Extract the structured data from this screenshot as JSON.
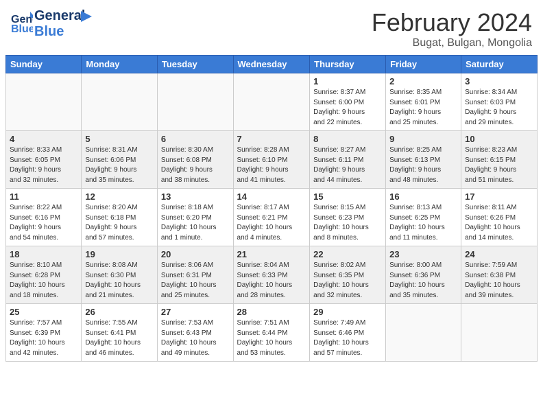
{
  "header": {
    "logo_line1": "General",
    "logo_line2": "Blue",
    "main_title": "February 2024",
    "subtitle": "Bugat, Bulgan, Mongolia"
  },
  "days_of_week": [
    "Sunday",
    "Monday",
    "Tuesday",
    "Wednesday",
    "Thursday",
    "Friday",
    "Saturday"
  ],
  "weeks": [
    [
      {
        "day": "",
        "info": "",
        "empty": true
      },
      {
        "day": "",
        "info": "",
        "empty": true
      },
      {
        "day": "",
        "info": "",
        "empty": true
      },
      {
        "day": "",
        "info": "",
        "empty": true
      },
      {
        "day": "1",
        "info": "Sunrise: 8:37 AM\nSunset: 6:00 PM\nDaylight: 9 hours\nand 22 minutes."
      },
      {
        "day": "2",
        "info": "Sunrise: 8:35 AM\nSunset: 6:01 PM\nDaylight: 9 hours\nand 25 minutes."
      },
      {
        "day": "3",
        "info": "Sunrise: 8:34 AM\nSunset: 6:03 PM\nDaylight: 9 hours\nand 29 minutes."
      }
    ],
    [
      {
        "day": "4",
        "info": "Sunrise: 8:33 AM\nSunset: 6:05 PM\nDaylight: 9 hours\nand 32 minutes."
      },
      {
        "day": "5",
        "info": "Sunrise: 8:31 AM\nSunset: 6:06 PM\nDaylight: 9 hours\nand 35 minutes."
      },
      {
        "day": "6",
        "info": "Sunrise: 8:30 AM\nSunset: 6:08 PM\nDaylight: 9 hours\nand 38 minutes."
      },
      {
        "day": "7",
        "info": "Sunrise: 8:28 AM\nSunset: 6:10 PM\nDaylight: 9 hours\nand 41 minutes."
      },
      {
        "day": "8",
        "info": "Sunrise: 8:27 AM\nSunset: 6:11 PM\nDaylight: 9 hours\nand 44 minutes."
      },
      {
        "day": "9",
        "info": "Sunrise: 8:25 AM\nSunset: 6:13 PM\nDaylight: 9 hours\nand 48 minutes."
      },
      {
        "day": "10",
        "info": "Sunrise: 8:23 AM\nSunset: 6:15 PM\nDaylight: 9 hours\nand 51 minutes."
      }
    ],
    [
      {
        "day": "11",
        "info": "Sunrise: 8:22 AM\nSunset: 6:16 PM\nDaylight: 9 hours\nand 54 minutes."
      },
      {
        "day": "12",
        "info": "Sunrise: 8:20 AM\nSunset: 6:18 PM\nDaylight: 9 hours\nand 57 minutes."
      },
      {
        "day": "13",
        "info": "Sunrise: 8:18 AM\nSunset: 6:20 PM\nDaylight: 10 hours\nand 1 minute."
      },
      {
        "day": "14",
        "info": "Sunrise: 8:17 AM\nSunset: 6:21 PM\nDaylight: 10 hours\nand 4 minutes."
      },
      {
        "day": "15",
        "info": "Sunrise: 8:15 AM\nSunset: 6:23 PM\nDaylight: 10 hours\nand 8 minutes."
      },
      {
        "day": "16",
        "info": "Sunrise: 8:13 AM\nSunset: 6:25 PM\nDaylight: 10 hours\nand 11 minutes."
      },
      {
        "day": "17",
        "info": "Sunrise: 8:11 AM\nSunset: 6:26 PM\nDaylight: 10 hours\nand 14 minutes."
      }
    ],
    [
      {
        "day": "18",
        "info": "Sunrise: 8:10 AM\nSunset: 6:28 PM\nDaylight: 10 hours\nand 18 minutes."
      },
      {
        "day": "19",
        "info": "Sunrise: 8:08 AM\nSunset: 6:30 PM\nDaylight: 10 hours\nand 21 minutes."
      },
      {
        "day": "20",
        "info": "Sunrise: 8:06 AM\nSunset: 6:31 PM\nDaylight: 10 hours\nand 25 minutes."
      },
      {
        "day": "21",
        "info": "Sunrise: 8:04 AM\nSunset: 6:33 PM\nDaylight: 10 hours\nand 28 minutes."
      },
      {
        "day": "22",
        "info": "Sunrise: 8:02 AM\nSunset: 6:35 PM\nDaylight: 10 hours\nand 32 minutes."
      },
      {
        "day": "23",
        "info": "Sunrise: 8:00 AM\nSunset: 6:36 PM\nDaylight: 10 hours\nand 35 minutes."
      },
      {
        "day": "24",
        "info": "Sunrise: 7:59 AM\nSunset: 6:38 PM\nDaylight: 10 hours\nand 39 minutes."
      }
    ],
    [
      {
        "day": "25",
        "info": "Sunrise: 7:57 AM\nSunset: 6:39 PM\nDaylight: 10 hours\nand 42 minutes."
      },
      {
        "day": "26",
        "info": "Sunrise: 7:55 AM\nSunset: 6:41 PM\nDaylight: 10 hours\nand 46 minutes."
      },
      {
        "day": "27",
        "info": "Sunrise: 7:53 AM\nSunset: 6:43 PM\nDaylight: 10 hours\nand 49 minutes."
      },
      {
        "day": "28",
        "info": "Sunrise: 7:51 AM\nSunset: 6:44 PM\nDaylight: 10 hours\nand 53 minutes."
      },
      {
        "day": "29",
        "info": "Sunrise: 7:49 AM\nSunset: 6:46 PM\nDaylight: 10 hours\nand 57 minutes."
      },
      {
        "day": "",
        "info": "",
        "empty": true
      },
      {
        "day": "",
        "info": "",
        "empty": true
      }
    ]
  ]
}
